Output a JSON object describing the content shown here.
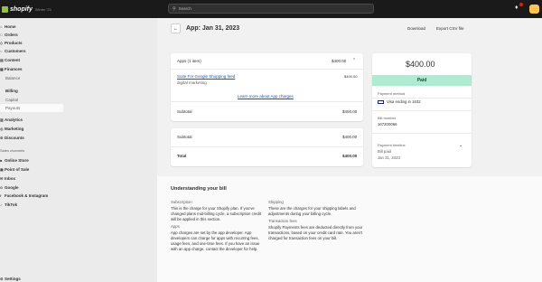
{
  "topbar": {
    "brand": "shopify",
    "version": "Winter '23",
    "search_placeholder": "Search",
    "notification_count": "1"
  },
  "sidebar": {
    "items": [
      {
        "label": "Home",
        "icon": "home-icon"
      },
      {
        "label": "Orders",
        "icon": "orders-icon"
      },
      {
        "label": "Products",
        "icon": "products-icon"
      },
      {
        "label": "Customers",
        "icon": "customers-icon"
      },
      {
        "label": "Content",
        "icon": "content-icon"
      },
      {
        "label": "Finances",
        "icon": "finances-icon"
      }
    ],
    "finance_sub": [
      {
        "label": "Balance"
      },
      {
        "label": "Billing"
      },
      {
        "label": "Capital"
      },
      {
        "label": "Payouts"
      }
    ],
    "items2": [
      {
        "label": "Analytics",
        "icon": "analytics-icon"
      },
      {
        "label": "Marketing",
        "icon": "marketing-icon"
      },
      {
        "label": "Discounts",
        "icon": "discounts-icon"
      }
    ],
    "sales_channels_label": "Sales channels",
    "channels": [
      {
        "label": "Online Store",
        "icon": "online-store-icon"
      },
      {
        "label": "Point of Sale",
        "icon": "pos-icon"
      },
      {
        "label": "Inbox",
        "icon": "inbox-icon"
      },
      {
        "label": "Google",
        "icon": "google-icon"
      },
      {
        "label": "Facebook & Instagram",
        "icon": "facebook-icon"
      },
      {
        "label": "TikTok",
        "icon": "tiktok-icon"
      }
    ],
    "settings": "Settings"
  },
  "page": {
    "title": "App: Jan 31, 2023",
    "download": "Download",
    "export": "Export CSV file"
  },
  "apps_card": {
    "header": "Apps (1 item)",
    "header_amount": "$400.00",
    "app_name": "Suite For Google Shopping feed",
    "app_category": "digital marketing",
    "app_amount": "$400.00",
    "learn_more": "Learn more about App charges",
    "subtotal_label": "Subtotal",
    "subtotal_amount": "$400.00"
  },
  "totals_card": {
    "subtotal_label": "Subtotal",
    "subtotal_amount": "$400.00",
    "total_label": "Total",
    "total_amount": "$400.00"
  },
  "summary_card": {
    "amount": "$400.00",
    "status": "Paid",
    "payment_method_label": "Payment method",
    "payment_method": "Visa ending in 1632",
    "bill_number_label": "Bill number",
    "bill_number": "167200066",
    "timeline_label": "Payment timeline",
    "timeline_status": "Bill paid",
    "timeline_date": "Jan 31, 2023"
  },
  "understanding": {
    "title": "Understanding your bill",
    "subscription_h": "Subscription",
    "subscription_p": "This is the charge for your Shopify plan. If you've changed plans mid-billing cycle, a subscription credit will be applied in this section.",
    "apps_h": "Apps",
    "apps_p": "App charges are set by the app developer. App developers can charge for apps with recurring fees, usage fees, and one-time fees. If you have an issue with an app charge, contact the developer for help.",
    "shipping_h": "Shipping",
    "shipping_p": "These are the charges for your shipping labels and adjustments during your billing cycle.",
    "transaction_h": "Transaction fees",
    "transaction_p": "Shopify Payments fees are deducted directly from your transactions, based on your credit card rate. You aren't charged for transaction fees on your bill."
  }
}
